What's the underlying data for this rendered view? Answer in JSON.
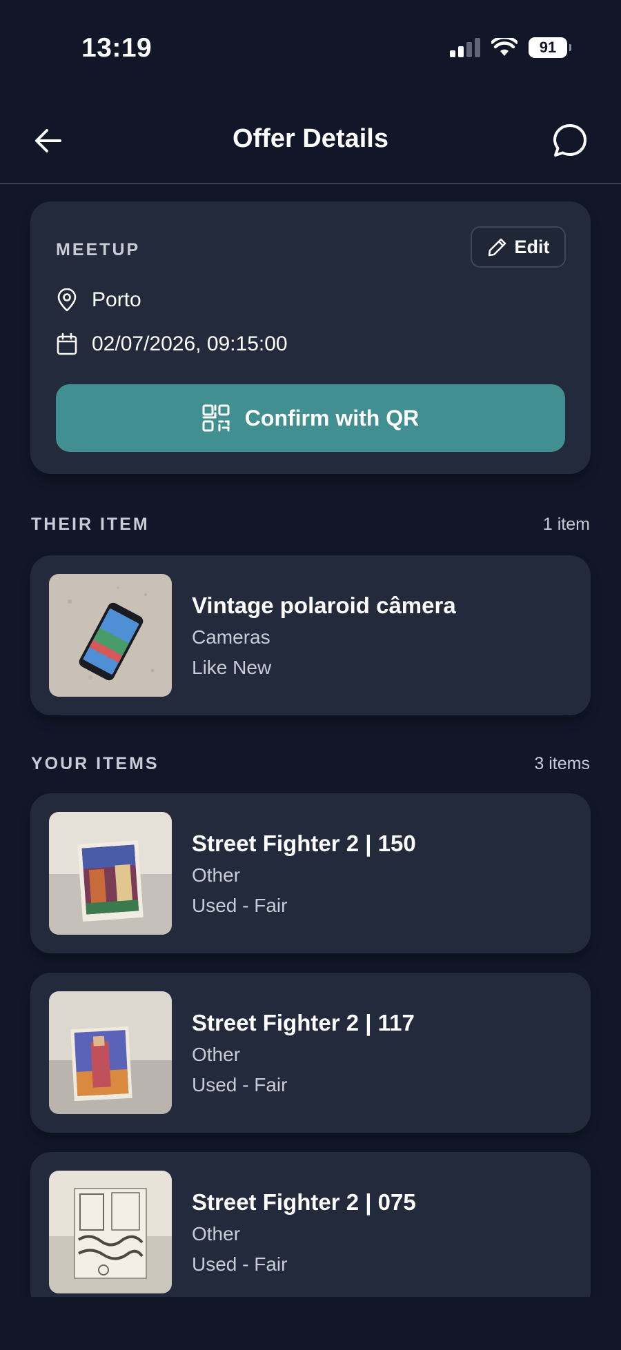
{
  "status_bar": {
    "time": "13:19",
    "battery": "91"
  },
  "header": {
    "title": "Offer Details"
  },
  "meetup": {
    "label": "MEETUP",
    "edit_label": "Edit",
    "location": "Porto",
    "datetime": "02/07/2026, 09:15:00",
    "confirm_label": "Confirm with QR",
    "accent_color": "#418f90"
  },
  "their_item": {
    "section_title": "THEIR ITEM",
    "count": "1 item",
    "items": [
      {
        "title": "Vintage polaroid câmera",
        "category": "Cameras",
        "condition": "Like New"
      }
    ]
  },
  "your_items": {
    "section_title": "YOUR ITEMS",
    "count": "3 items",
    "items": [
      {
        "title": "Street Fighter 2 | 150",
        "category": "Other",
        "condition": "Used - Fair"
      },
      {
        "title": "Street Fighter 2 | 117",
        "category": "Other",
        "condition": "Used - Fair"
      },
      {
        "title": "Street Fighter 2 | 075",
        "category": "Other",
        "condition": "Used - Fair"
      }
    ]
  }
}
